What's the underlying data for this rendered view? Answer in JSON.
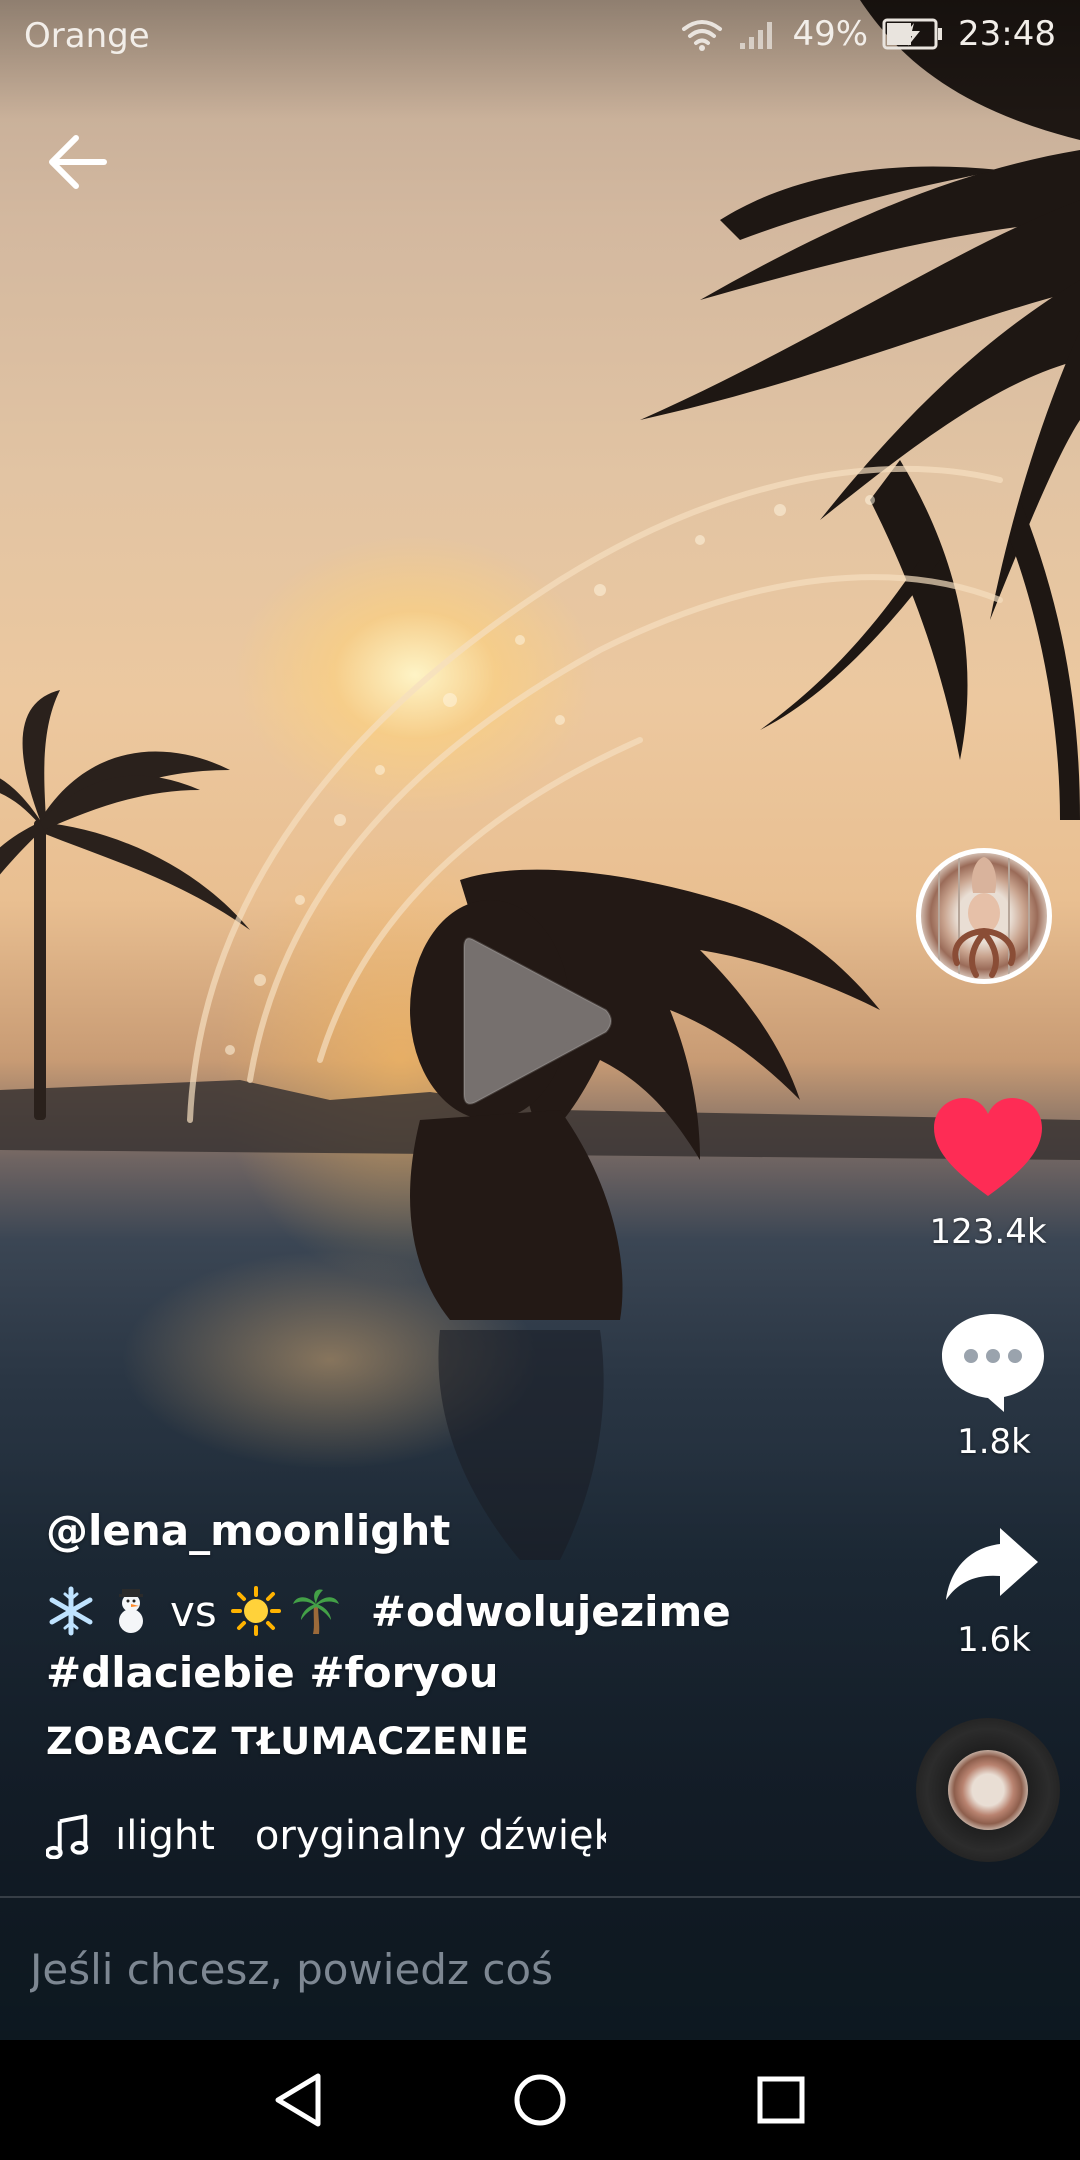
{
  "status_bar": {
    "carrier": "Orange",
    "battery_percent": "49%",
    "time": "23:48",
    "icons": [
      "wifi-icon",
      "signal-icon",
      "battery-charging-icon"
    ]
  },
  "header": {
    "back_icon": "arrow-left-icon"
  },
  "video": {
    "state": "paused",
    "play_icon": "play-icon"
  },
  "actions": {
    "likes": "123.4k",
    "comments": "1.8k",
    "shares": "1.6k",
    "like_color": "#fe2c55"
  },
  "caption": {
    "username": "@lena_moonlight",
    "emoji_before": [
      "snowflake-emoji",
      "snowman-emoji"
    ],
    "vs": "vs",
    "emoji_after": [
      "sun-emoji",
      "palm-tree-emoji"
    ],
    "hashtag1": "#odwolujezime",
    "hashtag2": "#dlaciebie",
    "hashtag3": "#foryou",
    "translate_label": "ZOBACZ TŁUMACZENIE"
  },
  "music": {
    "scroll_part1": "ılight",
    "scroll_part2": "oryginalny dźwięk",
    "note_icon": "music-note-icon"
  },
  "comment_bar": {
    "placeholder": "Jeśli chcesz, powiedz coś"
  },
  "nav": {
    "icons": [
      "nav-back-icon",
      "nav-home-icon",
      "nav-recents-icon"
    ]
  }
}
